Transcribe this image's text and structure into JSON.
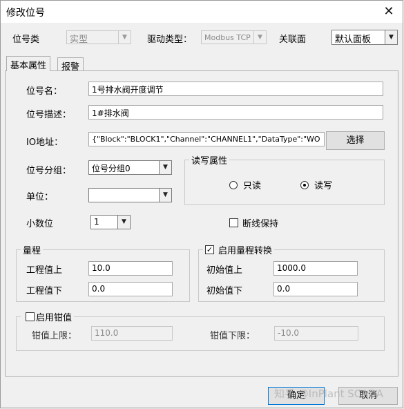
{
  "window": {
    "title": "修改位号",
    "close_glyph": "✕"
  },
  "top_row": {
    "tag_type_label": "位号类",
    "tag_type_value": "实型",
    "driver_type_label": "驱动类型：",
    "driver_type_value": "Modbus TCP",
    "related_panel_label": "关联面",
    "related_panel_value": "默认面板"
  },
  "tabs": [
    {
      "label": "基本属性"
    },
    {
      "label": "报警"
    }
  ],
  "basic": {
    "tag_name_label": "位号名：",
    "tag_name_value": "1号排水阀开度调节",
    "tag_desc_label": "位号描述：",
    "tag_desc_value": "1#排水阀",
    "io_label": "IO地址：",
    "io_value": "{\"Block\":\"BLOCK1\",\"Channel\":\"CHANNEL1\",\"DataType\":\"WO",
    "select_button": "选择",
    "group_label": "位号分组：",
    "group_value": "位号分组0",
    "unit_label": "单位：",
    "unit_value": "",
    "decimal_label": "小数位",
    "decimal_value": "1",
    "rw": {
      "legend": "读写属性",
      "readonly_label": "只读",
      "readwrite_label": "读写",
      "readonly_checked": false,
      "readwrite_checked": true
    },
    "disconnect_hold_label": "断线保持",
    "disconnect_hold_checked": false
  },
  "range": {
    "legend": "量程",
    "eng_high_label": "工程值上",
    "eng_high_value": "10.0",
    "eng_low_label": "工程值下",
    "eng_low_value": "0.0"
  },
  "range_conversion": {
    "legend": "启用量程转换",
    "checked": true,
    "raw_high_label": "初始值上",
    "raw_high_value": "1000.0",
    "raw_low_label": "初始值下",
    "raw_low_value": "0.0"
  },
  "clamp": {
    "legend": "启用钳值",
    "checked": false,
    "upper_label": "钳值上限：",
    "upper_value": "110.0",
    "lower_label": "钳值下限：",
    "lower_value": "-10.0"
  },
  "footer": {
    "ok_button": "确定",
    "cancel_button": "取消"
  },
  "watermark": "知乎 @InPlant SCADA"
}
